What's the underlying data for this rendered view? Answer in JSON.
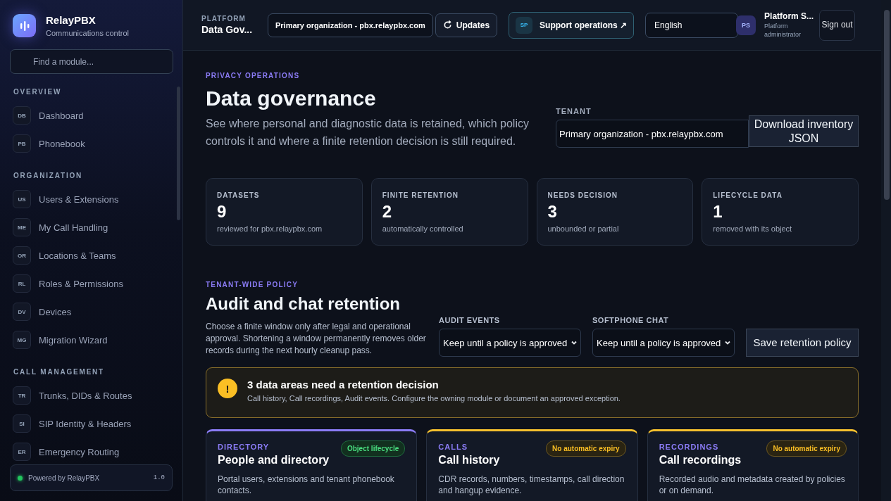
{
  "sidebar": {
    "brand": {
      "name": "RelayPBX",
      "subtitle": "Communications control"
    },
    "search": {
      "placeholder": "Find a module..."
    },
    "sections": [
      {
        "title": "OVERVIEW",
        "items": [
          {
            "badge": "DB",
            "label": "Dashboard",
            "selected": false
          },
          {
            "badge": "PB",
            "label": "Phonebook",
            "selected": false
          }
        ]
      },
      {
        "title": "ORGANIZATION",
        "items": [
          {
            "badge": "US",
            "label": "Users & Extensions",
            "selected": false
          },
          {
            "badge": "ME",
            "label": "My Call Handling",
            "selected": false
          },
          {
            "badge": "OR",
            "label": "Locations & Teams",
            "selected": false
          },
          {
            "badge": "RL",
            "label": "Roles & Permissions",
            "selected": false
          },
          {
            "badge": "DV",
            "label": "Devices",
            "selected": false
          },
          {
            "badge": "MG",
            "label": "Migration Wizard",
            "selected": false
          }
        ]
      },
      {
        "title": "CALL MANAGEMENT",
        "items": [
          {
            "badge": "TR",
            "label": "Trunks, DIDs & Routes",
            "selected": false
          },
          {
            "badge": "SI",
            "label": "SIP Identity & Headers",
            "selected": false
          },
          {
            "badge": "ER",
            "label": "Emergency Routing",
            "selected": false
          }
        ]
      }
    ],
    "footer": {
      "label": "Powered by RelayPBX",
      "version": "1.0"
    }
  },
  "header": {
    "context": {
      "label": "PLATFORM",
      "title": "Data Gov..."
    },
    "tenant_select": {
      "value": "Primary organization - pbx.relaypbx.com"
    },
    "updates_button": {
      "label": "Updates"
    },
    "support_button": {
      "badge": "SP",
      "label": "Support operations",
      "arrow": "↗"
    },
    "language_select": {
      "value": "English"
    },
    "user": {
      "initials": "PS",
      "name": "Platform S...",
      "role": "Platform administrator"
    },
    "sign_out": {
      "label": "Sign out"
    }
  },
  "page": {
    "eyebrow": "PRIVACY OPERATIONS",
    "title": "Data governance",
    "description": "See where personal and diagnostic data is retained, which policy controls it and where a finite retention decision is still required.",
    "tenant": {
      "label": "TENANT",
      "value": "Primary organization - pbx.relaypbx.com"
    },
    "download_button": {
      "label": "Download inventory JSON"
    },
    "stats": [
      {
        "label": "DATASETS",
        "value": "9",
        "caption": "reviewed for pbx.relaypbx.com"
      },
      {
        "label": "FINITE RETENTION",
        "value": "2",
        "caption": "automatically controlled"
      },
      {
        "label": "NEEDS DECISION",
        "value": "3",
        "caption": "unbounded or partial"
      },
      {
        "label": "LIFECYCLE DATA",
        "value": "1",
        "caption": "removed with its object"
      }
    ],
    "policy": {
      "eyebrow": "TENANT-WIDE POLICY",
      "title": "Audit and chat retention",
      "description": "Choose a finite window only after legal and operational approval. Shortening a window permanently removes older records during the next hourly cleanup pass.",
      "fields": [
        {
          "label": "AUDIT EVENTS",
          "value": "Keep until a policy is approved"
        },
        {
          "label": "SOFTPHONE CHAT",
          "value": "Keep until a policy is approved"
        }
      ],
      "save_button": {
        "label": "Save retention policy"
      }
    },
    "alert": {
      "icon": "!",
      "title": "3 data areas need a retention decision",
      "text": "Call history, Call recordings, Audit events. Configure the owning module or document an approved exception."
    },
    "cards": [
      {
        "kind": "lifecycle",
        "category": "DIRECTORY",
        "title": "People and directory",
        "badge": "Object lifecycle",
        "description": "Portal users, extensions and tenant phonebook contacts."
      },
      {
        "kind": "expiry",
        "category": "CALLS",
        "title": "Call history",
        "badge": "No automatic expiry",
        "description": "CDR records, numbers, timestamps, call direction and hangup evidence."
      },
      {
        "kind": "expiry",
        "category": "RECORDINGS",
        "title": "Call recordings",
        "badge": "No automatic expiry",
        "description": "Recorded audio and metadata created by policies or on demand."
      }
    ]
  }
}
